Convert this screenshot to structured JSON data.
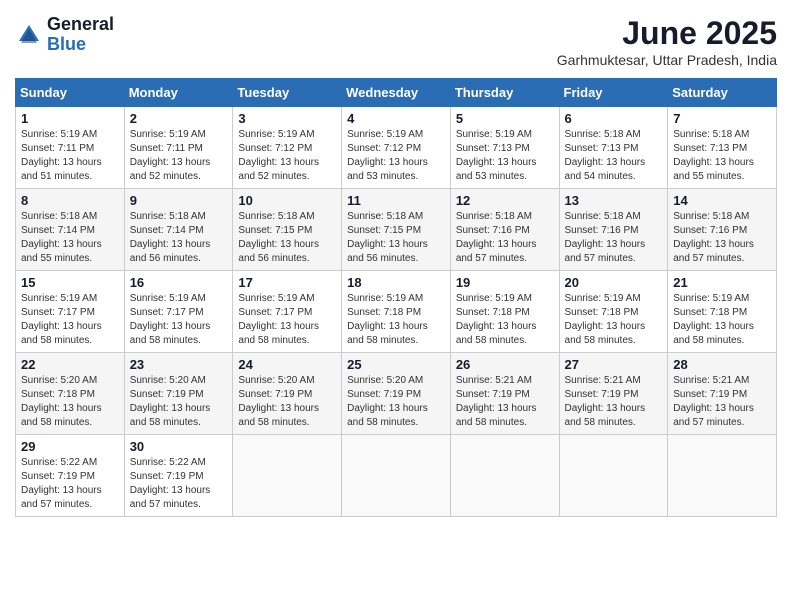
{
  "logo": {
    "general": "General",
    "blue": "Blue"
  },
  "title": {
    "month_year": "June 2025",
    "location": "Garhmuktesar, Uttar Pradesh, India"
  },
  "days_of_week": [
    "Sunday",
    "Monday",
    "Tuesday",
    "Wednesday",
    "Thursday",
    "Friday",
    "Saturday"
  ],
  "weeks": [
    [
      {
        "day": "1",
        "sunrise": "5:19 AM",
        "sunset": "7:11 PM",
        "daylight": "13 hours and 51 minutes."
      },
      {
        "day": "2",
        "sunrise": "5:19 AM",
        "sunset": "7:11 PM",
        "daylight": "13 hours and 52 minutes."
      },
      {
        "day": "3",
        "sunrise": "5:19 AM",
        "sunset": "7:12 PM",
        "daylight": "13 hours and 52 minutes."
      },
      {
        "day": "4",
        "sunrise": "5:19 AM",
        "sunset": "7:12 PM",
        "daylight": "13 hours and 53 minutes."
      },
      {
        "day": "5",
        "sunrise": "5:19 AM",
        "sunset": "7:13 PM",
        "daylight": "13 hours and 53 minutes."
      },
      {
        "day": "6",
        "sunrise": "5:18 AM",
        "sunset": "7:13 PM",
        "daylight": "13 hours and 54 minutes."
      },
      {
        "day": "7",
        "sunrise": "5:18 AM",
        "sunset": "7:13 PM",
        "daylight": "13 hours and 55 minutes."
      }
    ],
    [
      {
        "day": "8",
        "sunrise": "5:18 AM",
        "sunset": "7:14 PM",
        "daylight": "13 hours and 55 minutes."
      },
      {
        "day": "9",
        "sunrise": "5:18 AM",
        "sunset": "7:14 PM",
        "daylight": "13 hours and 56 minutes."
      },
      {
        "day": "10",
        "sunrise": "5:18 AM",
        "sunset": "7:15 PM",
        "daylight": "13 hours and 56 minutes."
      },
      {
        "day": "11",
        "sunrise": "5:18 AM",
        "sunset": "7:15 PM",
        "daylight": "13 hours and 56 minutes."
      },
      {
        "day": "12",
        "sunrise": "5:18 AM",
        "sunset": "7:16 PM",
        "daylight": "13 hours and 57 minutes."
      },
      {
        "day": "13",
        "sunrise": "5:18 AM",
        "sunset": "7:16 PM",
        "daylight": "13 hours and 57 minutes."
      },
      {
        "day": "14",
        "sunrise": "5:18 AM",
        "sunset": "7:16 PM",
        "daylight": "13 hours and 57 minutes."
      }
    ],
    [
      {
        "day": "15",
        "sunrise": "5:19 AM",
        "sunset": "7:17 PM",
        "daylight": "13 hours and 58 minutes."
      },
      {
        "day": "16",
        "sunrise": "5:19 AM",
        "sunset": "7:17 PM",
        "daylight": "13 hours and 58 minutes."
      },
      {
        "day": "17",
        "sunrise": "5:19 AM",
        "sunset": "7:17 PM",
        "daylight": "13 hours and 58 minutes."
      },
      {
        "day": "18",
        "sunrise": "5:19 AM",
        "sunset": "7:18 PM",
        "daylight": "13 hours and 58 minutes."
      },
      {
        "day": "19",
        "sunrise": "5:19 AM",
        "sunset": "7:18 PM",
        "daylight": "13 hours and 58 minutes."
      },
      {
        "day": "20",
        "sunrise": "5:19 AM",
        "sunset": "7:18 PM",
        "daylight": "13 hours and 58 minutes."
      },
      {
        "day": "21",
        "sunrise": "5:19 AM",
        "sunset": "7:18 PM",
        "daylight": "13 hours and 58 minutes."
      }
    ],
    [
      {
        "day": "22",
        "sunrise": "5:20 AM",
        "sunset": "7:18 PM",
        "daylight": "13 hours and 58 minutes."
      },
      {
        "day": "23",
        "sunrise": "5:20 AM",
        "sunset": "7:19 PM",
        "daylight": "13 hours and 58 minutes."
      },
      {
        "day": "24",
        "sunrise": "5:20 AM",
        "sunset": "7:19 PM",
        "daylight": "13 hours and 58 minutes."
      },
      {
        "day": "25",
        "sunrise": "5:20 AM",
        "sunset": "7:19 PM",
        "daylight": "13 hours and 58 minutes."
      },
      {
        "day": "26",
        "sunrise": "5:21 AM",
        "sunset": "7:19 PM",
        "daylight": "13 hours and 58 minutes."
      },
      {
        "day": "27",
        "sunrise": "5:21 AM",
        "sunset": "7:19 PM",
        "daylight": "13 hours and 58 minutes."
      },
      {
        "day": "28",
        "sunrise": "5:21 AM",
        "sunset": "7:19 PM",
        "daylight": "13 hours and 57 minutes."
      }
    ],
    [
      {
        "day": "29",
        "sunrise": "5:22 AM",
        "sunset": "7:19 PM",
        "daylight": "13 hours and 57 minutes."
      },
      {
        "day": "30",
        "sunrise": "5:22 AM",
        "sunset": "7:19 PM",
        "daylight": "13 hours and 57 minutes."
      },
      null,
      null,
      null,
      null,
      null
    ]
  ]
}
